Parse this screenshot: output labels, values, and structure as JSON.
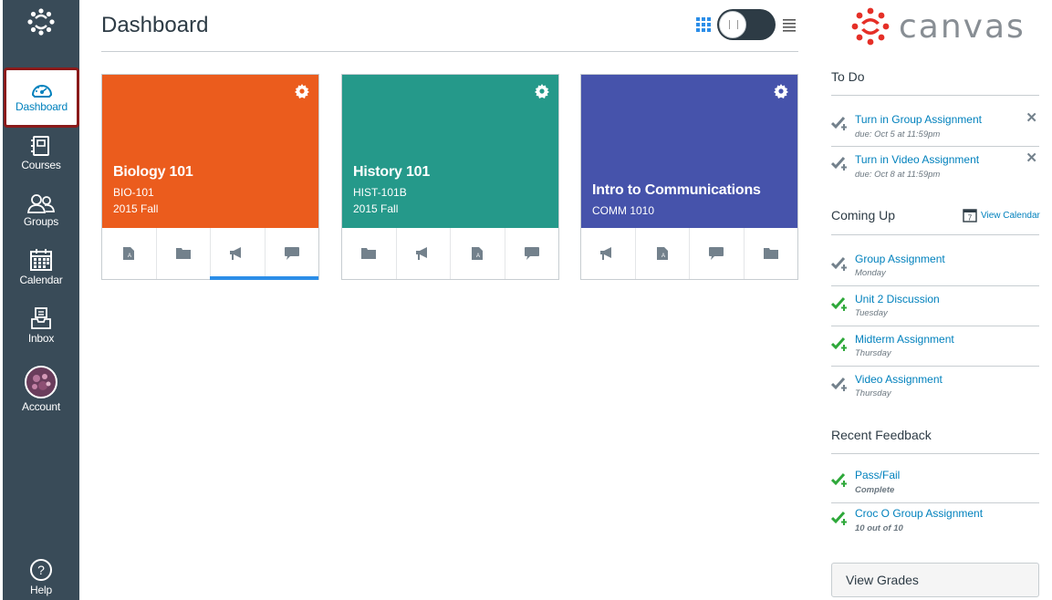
{
  "nav": {
    "items": [
      {
        "label": "Dashboard",
        "icon": "dashboard-icon"
      },
      {
        "label": "Courses",
        "icon": "courses-icon"
      },
      {
        "label": "Groups",
        "icon": "groups-icon"
      },
      {
        "label": "Calendar",
        "icon": "calendar-icon"
      },
      {
        "label": "Inbox",
        "icon": "inbox-icon"
      },
      {
        "label": "Account",
        "icon": "avatar"
      },
      {
        "label": "Help",
        "icon": "help-icon"
      }
    ]
  },
  "header": {
    "title": "Dashboard"
  },
  "cards": [
    {
      "title": "Biology 101",
      "code": "BIO-101",
      "term": "2015 Fall",
      "color": "#eb5c1d",
      "actions": [
        "assignments-icon",
        "files-icon",
        "announcements-icon",
        "discussions-icon"
      ]
    },
    {
      "title": "History 101",
      "code": "HIST-101B",
      "term": "2015 Fall",
      "color": "#25998a",
      "actions": [
        "files-icon",
        "announcements-icon",
        "assignments-icon",
        "discussions-icon"
      ]
    },
    {
      "title": "Intro to Communications",
      "code": "COMM 1010",
      "term": "",
      "color": "#4653ab",
      "actions": [
        "announcements-icon",
        "assignments-icon",
        "discussions-icon",
        "files-icon"
      ]
    }
  ],
  "sidebar": {
    "logo_text": "canvas",
    "todo": {
      "heading": "To Do",
      "items": [
        {
          "title": "Turn in Group Assignment",
          "due": "due: Oct 5 at 11:59pm"
        },
        {
          "title": "Turn in Video Assignment",
          "due": "due: Oct 8 at 11:59pm"
        }
      ]
    },
    "coming_up": {
      "heading": "Coming Up",
      "view_calendar": "View Calendar",
      "calendar_day": "7",
      "items": [
        {
          "title": "Group Assignment",
          "when": "Monday",
          "status": "gray"
        },
        {
          "title": "Unit 2 Discussion",
          "when": "Tuesday",
          "status": "green"
        },
        {
          "title": "Midterm Assignment",
          "when": "Thursday",
          "status": "green"
        },
        {
          "title": "Video Assignment",
          "when": "Thursday",
          "status": "gray"
        }
      ]
    },
    "feedback": {
      "heading": "Recent Feedback",
      "items": [
        {
          "title": "Pass/Fail",
          "detail": "Complete"
        },
        {
          "title": "Croc O Group Assignment",
          "detail": "10 out of 10"
        }
      ]
    },
    "view_grades": "View Grades"
  },
  "colors": {
    "nav_bg": "#394b58",
    "link": "#0081bd",
    "active_border": "#8a1a1a",
    "check_green": "#2ea83a",
    "check_gray": "#73818c",
    "unread_bar": "#2c8ee8",
    "brand_red": "#e52f27"
  }
}
